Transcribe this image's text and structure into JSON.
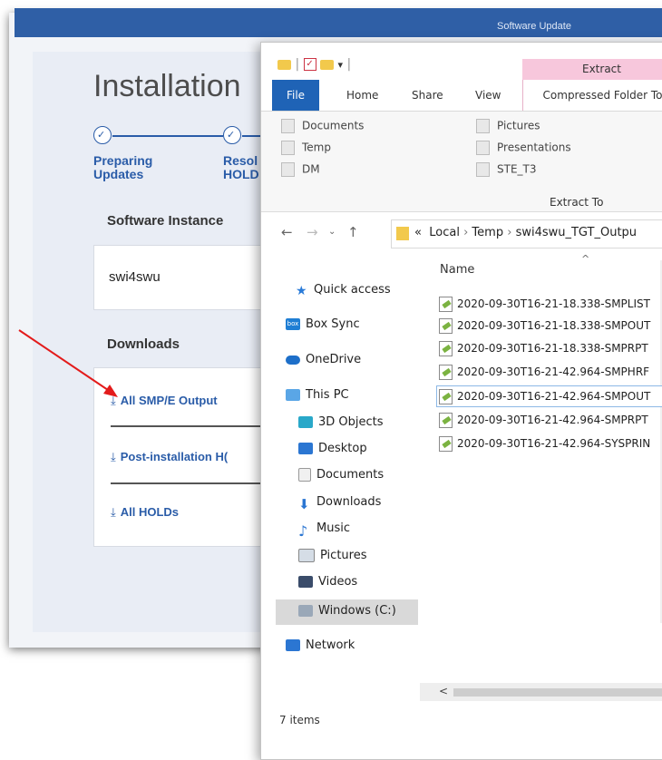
{
  "background_app": {
    "header_title": "Software Update",
    "page_title": "Installation",
    "steps": [
      {
        "label": "Preparing\nUpdates"
      },
      {
        "label": "Resol\nHOLD"
      }
    ],
    "software_instance": {
      "label": "Software Instance",
      "value": "swi4swu"
    },
    "downloads": {
      "label": "Downloads",
      "items": [
        {
          "label": "All SMP/E Output"
        },
        {
          "label": "Post-installation H("
        },
        {
          "label": "All HOLDs"
        }
      ]
    },
    "colors": {
      "accent": "#2a5ca8",
      "header": "#2f5fa6",
      "annotation_arrow": "#e31b1b"
    }
  },
  "explorer": {
    "contextual_tab": "Extract",
    "tabs": {
      "file": "File",
      "home": "Home",
      "share": "Share",
      "view": "View",
      "compressed": "Compressed Folder To"
    },
    "ribbon": {
      "destinations_col1": [
        "Documents",
        "Temp",
        "DM"
      ],
      "destinations_col2": [
        "Pictures",
        "Presentations",
        "STE_T3"
      ],
      "group_label": "Extract To"
    },
    "address": {
      "prefix": "«",
      "parts": [
        "Local",
        "Temp",
        "swi4swu_TGT_Outpu"
      ]
    },
    "nav": {
      "quick_access": "Quick access",
      "box_sync": "Box Sync",
      "onedrive": "OneDrive",
      "this_pc": "This PC",
      "objects3d": "3D Objects",
      "desktop": "Desktop",
      "documents": "Documents",
      "downloads": "Downloads",
      "music": "Music",
      "pictures": "Pictures",
      "videos": "Videos",
      "windows_c": "Windows (C:)",
      "network": "Network"
    },
    "column_name": "Name",
    "files": [
      "2020-09-30T16-21-18.338-SMPLIST",
      "2020-09-30T16-21-18.338-SMPOUT",
      "2020-09-30T16-21-18.338-SMPRPT",
      "2020-09-30T16-21-42.964-SMPHRF",
      "2020-09-30T16-21-42.964-SMPOUT",
      "2020-09-30T16-21-42.964-SMPRPT",
      "2020-09-30T16-21-42.964-SYSPRIN"
    ],
    "status": "7 items"
  }
}
